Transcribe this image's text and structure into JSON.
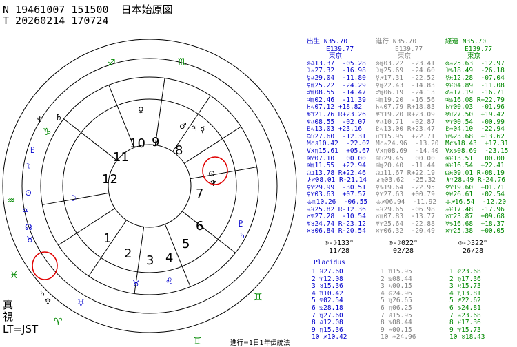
{
  "header": {
    "line1": "N 19461007 151500  日本始原図",
    "line2": "T 20260214 170724"
  },
  "side_labels": {
    "shin": "真",
    "shi": "視",
    "lt": "LT=JST"
  },
  "footer_note": "進行=1日1年伝統法",
  "houses": [
    "1",
    "2",
    "3",
    "4",
    "5",
    "6",
    "7",
    "8",
    "9",
    "10",
    "11",
    "12"
  ],
  "columns": [
    {
      "id": "natal",
      "title": "出生",
      "lat": "N35.70",
      "lon": "E139.77",
      "place": "東京",
      "color": "#0000cc",
      "rows": [
        "⊙♎13.37  -05.28",
        "☽♒27.32  -16.98",
        "☿♎29.04  -11.80",
        "♀♏25.22  -24.29",
        "♂♏08.55  -14.47",
        "♃♏02.46  -11.39",
        "♄♌07.12 +18.82",
        "♅♊21.76 R+23.26",
        "♆♎08.55  -02.07",
        "♇♌13.03 +23.16",
        "☊♉27.60  -12.31",
        "Mc♐10.42  -22.02",
        "Vx♏15.61  +05.67",
        "♃♈07.10   00.00",
        "♃♏11.55  +22.94",
        "☊♊13.78 R+22.46",
        "⚷♐08.01 R-21.14",
        "♀♈29.99  -30.51",
        "♀♈03.63  +07.57",
        "⚶♏10.26  -06.55",
        "♒♓25.82 R-12.36",
        "♉♋27.28  -10.54",
        "♅♉24.74 R-23.12",
        "✕♉06.84 R-20.54"
      ],
      "aspect": "⊙-☽133°",
      "date": "11/28",
      "system": "Placidus",
      "cusps": [
        "1 ♓27.60",
        "2 ♈12.08",
        "3 ♉15.36",
        "4 ♊10.42",
        "5 ♋02.54",
        "6 ♋28.18",
        "7 ♍27.60",
        "8 ♎12.08",
        "9 ♏15.36",
        "10 ♐10.42"
      ]
    },
    {
      "id": "progressed",
      "title": "進行",
      "lat": "N35.70",
      "lon": "E139.77",
      "place": "東京",
      "color": "#808080",
      "rows": [
        "⊙♍03.22  -23.41",
        "☽♍25.69  -24.60",
        "☿♐17.31  -22.52",
        "♀♍22.43  -14.83",
        "♂♍06.19  -24.13",
        "♃♏19.20  -16.56",
        "♄♌07.79 R+18.83",
        "♅♊19.20 R+23.09",
        "♆♎10.71  -02.87",
        "♇♌13.00 R+23.47",
        "♉♊15.95  +22.71",
        "Mc♒24.96  -13.20",
        "Vx♏08.69  -14.40",
        "♃♉29.45   00.00",
        "♃♍20.40  -11.44",
        "☊♊11.67 R+22.19",
        "⚷♍03.62  -25.32",
        "♀♑19.64  -22.95",
        "♀♈27.63  +00.79",
        "⚶♐06.94  -11.92",
        "♒♓29.65  -06.98",
        "♉♏07.83  -13.77",
        "♅♈25.64  -22.88",
        "✕♈06.32  -20.49"
      ],
      "aspect": "⊙-☽022°",
      "date": "02/28",
      "system": "",
      "cusps": [
        "1 ♊15.95",
        "2 ♋08.44",
        "3 ♌00.15",
        "4 ♌24.96",
        "5 ♍26.65",
        "6 ♏06.25",
        "7 ♐15.95",
        "8 ♑08.44",
        "9 ♒00.15",
        "10 ♒24.96"
      ]
    },
    {
      "id": "transit",
      "title": "経過",
      "lat": "N35.70",
      "lon": "E139.77",
      "place": "東京",
      "color": "#008800",
      "rows": [
        "⊙♒25.63  -12.97",
        "☽♑18.49  -26.18",
        "☿♓12.28  -07.04",
        "♀♓04.89  -11.08",
        "♂♒17.19  -16.71",
        "♃♋16.08 R+22.79",
        "♄♈00.03  -01.96",
        "♅♉27.50  +19.42",
        "♆♈00.54  -00.99",
        "♇♒04.10  -22.94",
        "♉♑23.68  +13.62",
        "Mc♑18.43  +17.31",
        "Vx♑08.69  -23.15",
        "♃♓13.51   00.00",
        "♃♓16.54  +22.41",
        "☊♓09.01 R-08.19",
        "⚷♈28.49 R-24.76",
        "♀♈19.60  +01.71",
        "♀♓26.61  -02.54",
        "⚶♐16.54  -12.20",
        "♒♓17.48  -17.96",
        "♉♊23.87  +09.68",
        "♅♑16.68  +18.37",
        "✕♈25.38  +00.05"
      ],
      "aspect": "⊙-☽322°",
      "date": "26/28",
      "system": "",
      "cusps": [
        "1 ♌23.68",
        "2 ♍17.36",
        "3 ♌15.73",
        "4 ♏13.81",
        "5 ♐22.62",
        "6 ♑24.81",
        "7 ♒23.68",
        "8 ♓17.36",
        "9 ♈15.73",
        "10 ♉18.43"
      ]
    }
  ]
}
